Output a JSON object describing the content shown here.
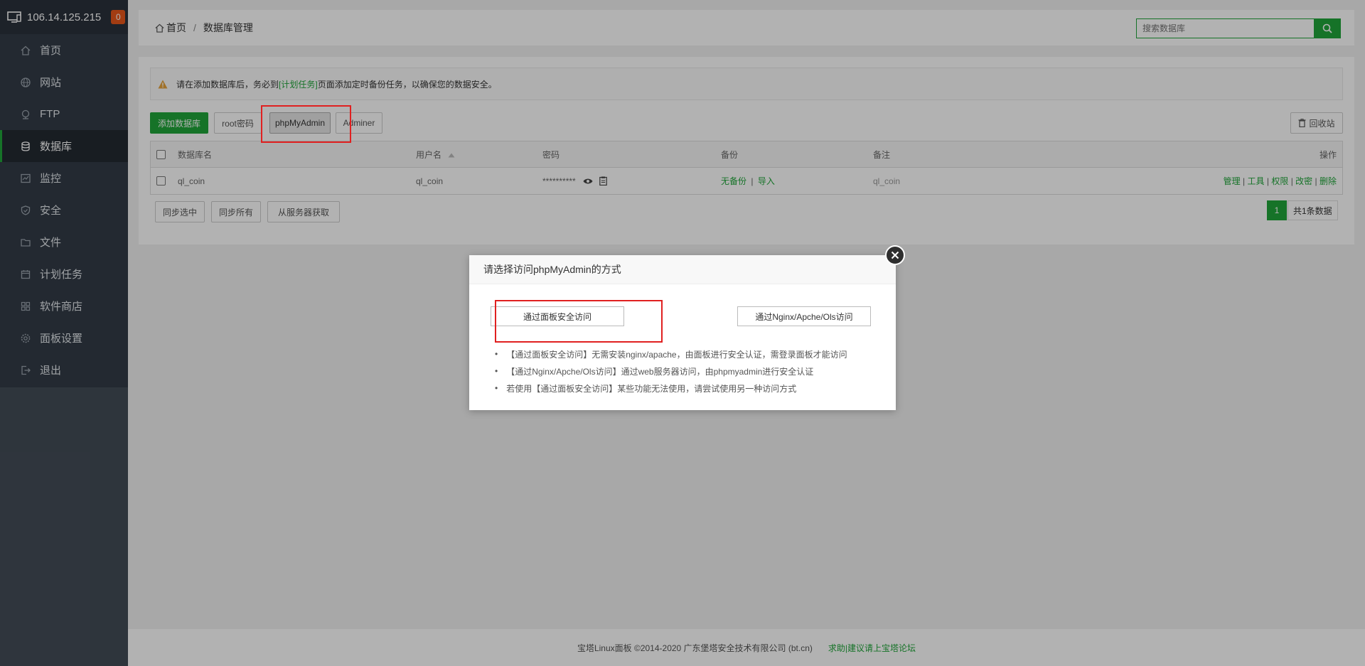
{
  "sidebar": {
    "ip": "106.14.125.215",
    "badge": "0",
    "items": [
      {
        "label": "首页",
        "icon": "home-icon"
      },
      {
        "label": "网站",
        "icon": "globe-icon"
      },
      {
        "label": "FTP",
        "icon": "ftp-icon"
      },
      {
        "label": "数据库",
        "icon": "database-icon",
        "active": true
      },
      {
        "label": "监控",
        "icon": "monitor-icon"
      },
      {
        "label": "安全",
        "icon": "shield-icon"
      },
      {
        "label": "文件",
        "icon": "folder-icon"
      },
      {
        "label": "计划任务",
        "icon": "calendar-icon"
      },
      {
        "label": "软件商店",
        "icon": "grid-icon"
      },
      {
        "label": "面板设置",
        "icon": "gear-icon"
      },
      {
        "label": "退出",
        "icon": "logout-icon"
      }
    ]
  },
  "header": {
    "breadcrumb_home": "首页",
    "breadcrumb_sep": "/",
    "breadcrumb_current": "数据库管理",
    "search_placeholder": "搜索数据库"
  },
  "alert": {
    "text_before": "请在添加数据库后，务必到",
    "link": "[计划任务]",
    "text_after": "页面添加定时备份任务，以确保您的数据安全。"
  },
  "toolbar": {
    "add_db": "添加数据库",
    "root_pwd": "root密码",
    "phpmyadmin": "phpMyAdmin",
    "adminer": "Adminer",
    "recycle": "回收站"
  },
  "table": {
    "headers": {
      "name": "数据库名",
      "user": "用户名",
      "password": "密码",
      "backup": "备份",
      "note": "备注",
      "actions": "操作"
    },
    "rows": [
      {
        "name": "ql_coin",
        "user": "ql_coin",
        "password": "**********",
        "backup_none": "无备份",
        "backup_sep": "|",
        "import": "导入",
        "note": "ql_coin",
        "actions": [
          "管理",
          "工具",
          "权限",
          "改密",
          "删除"
        ]
      }
    ]
  },
  "bottom": {
    "sync_selected": "同步选中",
    "sync_all": "同步所有",
    "fetch_server": "从服务器获取",
    "page": "1",
    "total": "共1条数据"
  },
  "footer": {
    "copyright": "宝塔Linux面板 ©2014-2020 广东堡塔安全技术有限公司 (bt.cn)",
    "link": "求助|建议请上宝塔论坛"
  },
  "modal": {
    "title": "请选择访问phpMyAdmin的方式",
    "btn_panel": "通过面板安全访问",
    "btn_nginx": "通过Nginx/Apche/Ols访问",
    "notes": [
      "【通过面板安全访问】无需安装nginx/apache，由面板进行安全认证，需登录面板才能访问",
      "【通过Nginx/Apche/Ols访问】通过web服务器访问，由phpmyadmin进行安全认证",
      "若使用【通过面板安全访问】某些功能无法使用，请尝试使用另一种访问方式"
    ]
  },
  "colors": {
    "accent": "#20a53a",
    "sidebar": "#333c47",
    "highlight": "#e02020",
    "badge": "#e8571b"
  }
}
